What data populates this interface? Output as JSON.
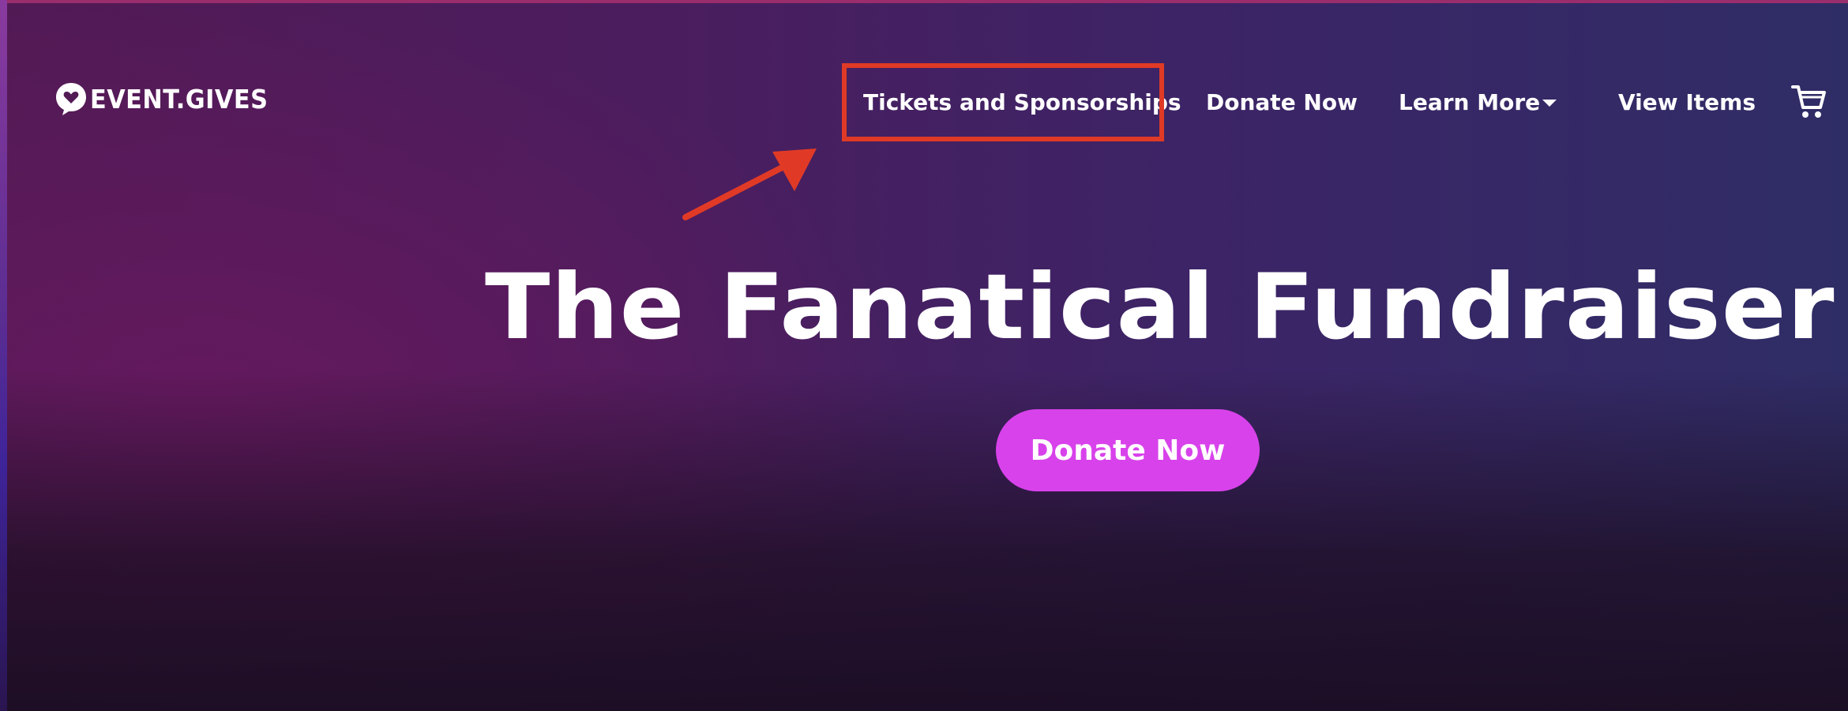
{
  "brand": {
    "name": "EVENT.GIVES",
    "logo_icon": "heart-speech-bubble-icon"
  },
  "nav": {
    "items": [
      {
        "label": "Tickets and Sponsorships",
        "highlighted": true
      },
      {
        "label": "Donate Now"
      },
      {
        "label": "Learn More",
        "has_dropdown": true,
        "dropdown_icon": "caret-down-icon"
      },
      {
        "label": "View Items"
      }
    ],
    "cart_icon": "shopping-cart-icon"
  },
  "annotation": {
    "type": "red box with arrow pointing to nav item",
    "color": "#e03a26"
  },
  "hero": {
    "title": "The Fanatical Fundraiser",
    "cta_label": "Donate Now",
    "cta_color": "#d842eb"
  },
  "colors": {
    "text": "#ffffff",
    "background_start": "#521a55",
    "background_end": "#2f2d66"
  }
}
